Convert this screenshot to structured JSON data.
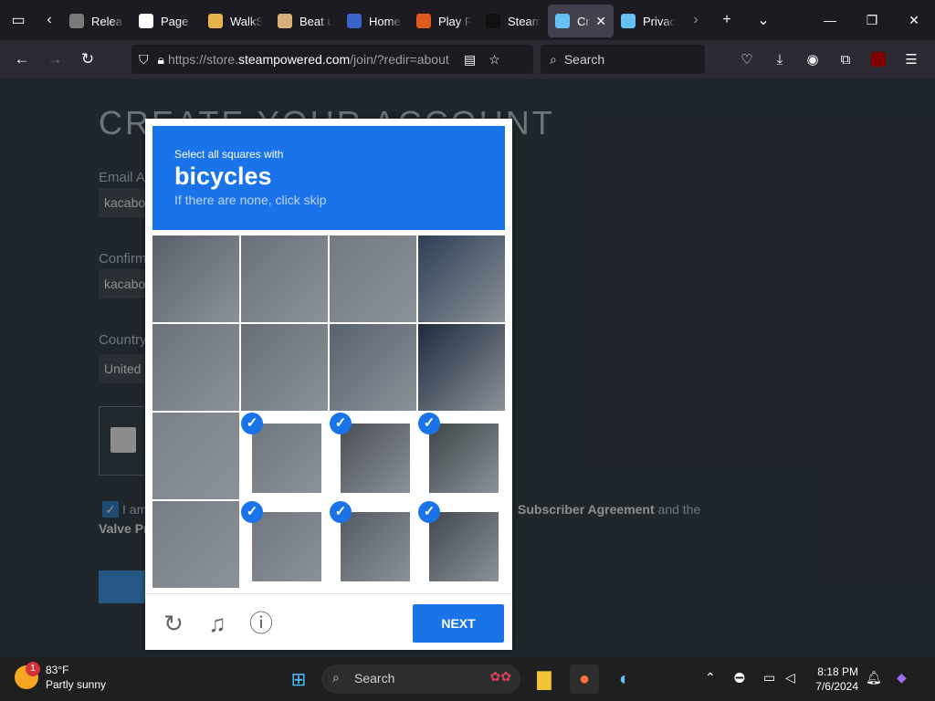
{
  "browser": {
    "tabs": [
      {
        "title": "Relea",
        "color": "#7a7a7a"
      },
      {
        "title": "Page",
        "color": "#ffffff"
      },
      {
        "title": "WalkS",
        "color": "#e6b34d"
      },
      {
        "title": "Beat u",
        "color": "#d9b07a"
      },
      {
        "title": "Home",
        "color": "#3c64c8"
      },
      {
        "title": "Play F",
        "color": "#e05a1e"
      },
      {
        "title": "Steam",
        "color": "#111111"
      },
      {
        "title": "Cre",
        "color": "#66c0f4",
        "active": true
      },
      {
        "title": "Privac",
        "color": "#66c0f4"
      }
    ],
    "url_prefix": "https://store.",
    "url_domain": "steampowered.com",
    "url_suffix": "/join/?redir=about",
    "search_placeholder": "Search"
  },
  "page": {
    "title": "CREATE YOUR ACCOUNT",
    "email_label": "Email A",
    "email_value": "kacabo",
    "confirm_label": "Confirm",
    "confirm_value": "kacabo",
    "country_label": "Country",
    "country_value": "United",
    "agree_prefix": "I am",
    "agreement_link": "Subscriber Agreement",
    "agree_and": " and the",
    "agree_line2": "Valve Pr"
  },
  "captcha": {
    "prompt_small": "Select all squares with",
    "prompt_target": "bicycles",
    "prompt_hint": "If there are none, click skip",
    "next_label": "NEXT",
    "tiles": [
      {
        "selected": false,
        "tone": "#5b6168"
      },
      {
        "selected": false,
        "tone": "#6a7178"
      },
      {
        "selected": false,
        "tone": "#737a80"
      },
      {
        "selected": false,
        "tone": "#2d3e55"
      },
      {
        "selected": false,
        "tone": "#6b7279"
      },
      {
        "selected": false,
        "tone": "#676e75"
      },
      {
        "selected": false,
        "tone": "#5a6270"
      },
      {
        "selected": false,
        "tone": "#1f2a3d"
      },
      {
        "selected": false,
        "tone": "#7b8289"
      },
      {
        "selected": true,
        "tone": "#6f767c"
      },
      {
        "selected": true,
        "tone": "#4b4f58"
      },
      {
        "selected": true,
        "tone": "#3e4548"
      },
      {
        "selected": false,
        "tone": "#777e85"
      },
      {
        "selected": true,
        "tone": "#70777e"
      },
      {
        "selected": true,
        "tone": "#555b62"
      },
      {
        "selected": true,
        "tone": "#41484e"
      }
    ]
  },
  "taskbar": {
    "badge": "1",
    "temperature": "83°F",
    "weather": "Partly sunny",
    "search_placeholder": "Search",
    "time": "8:18 PM",
    "date": "7/6/2024"
  }
}
